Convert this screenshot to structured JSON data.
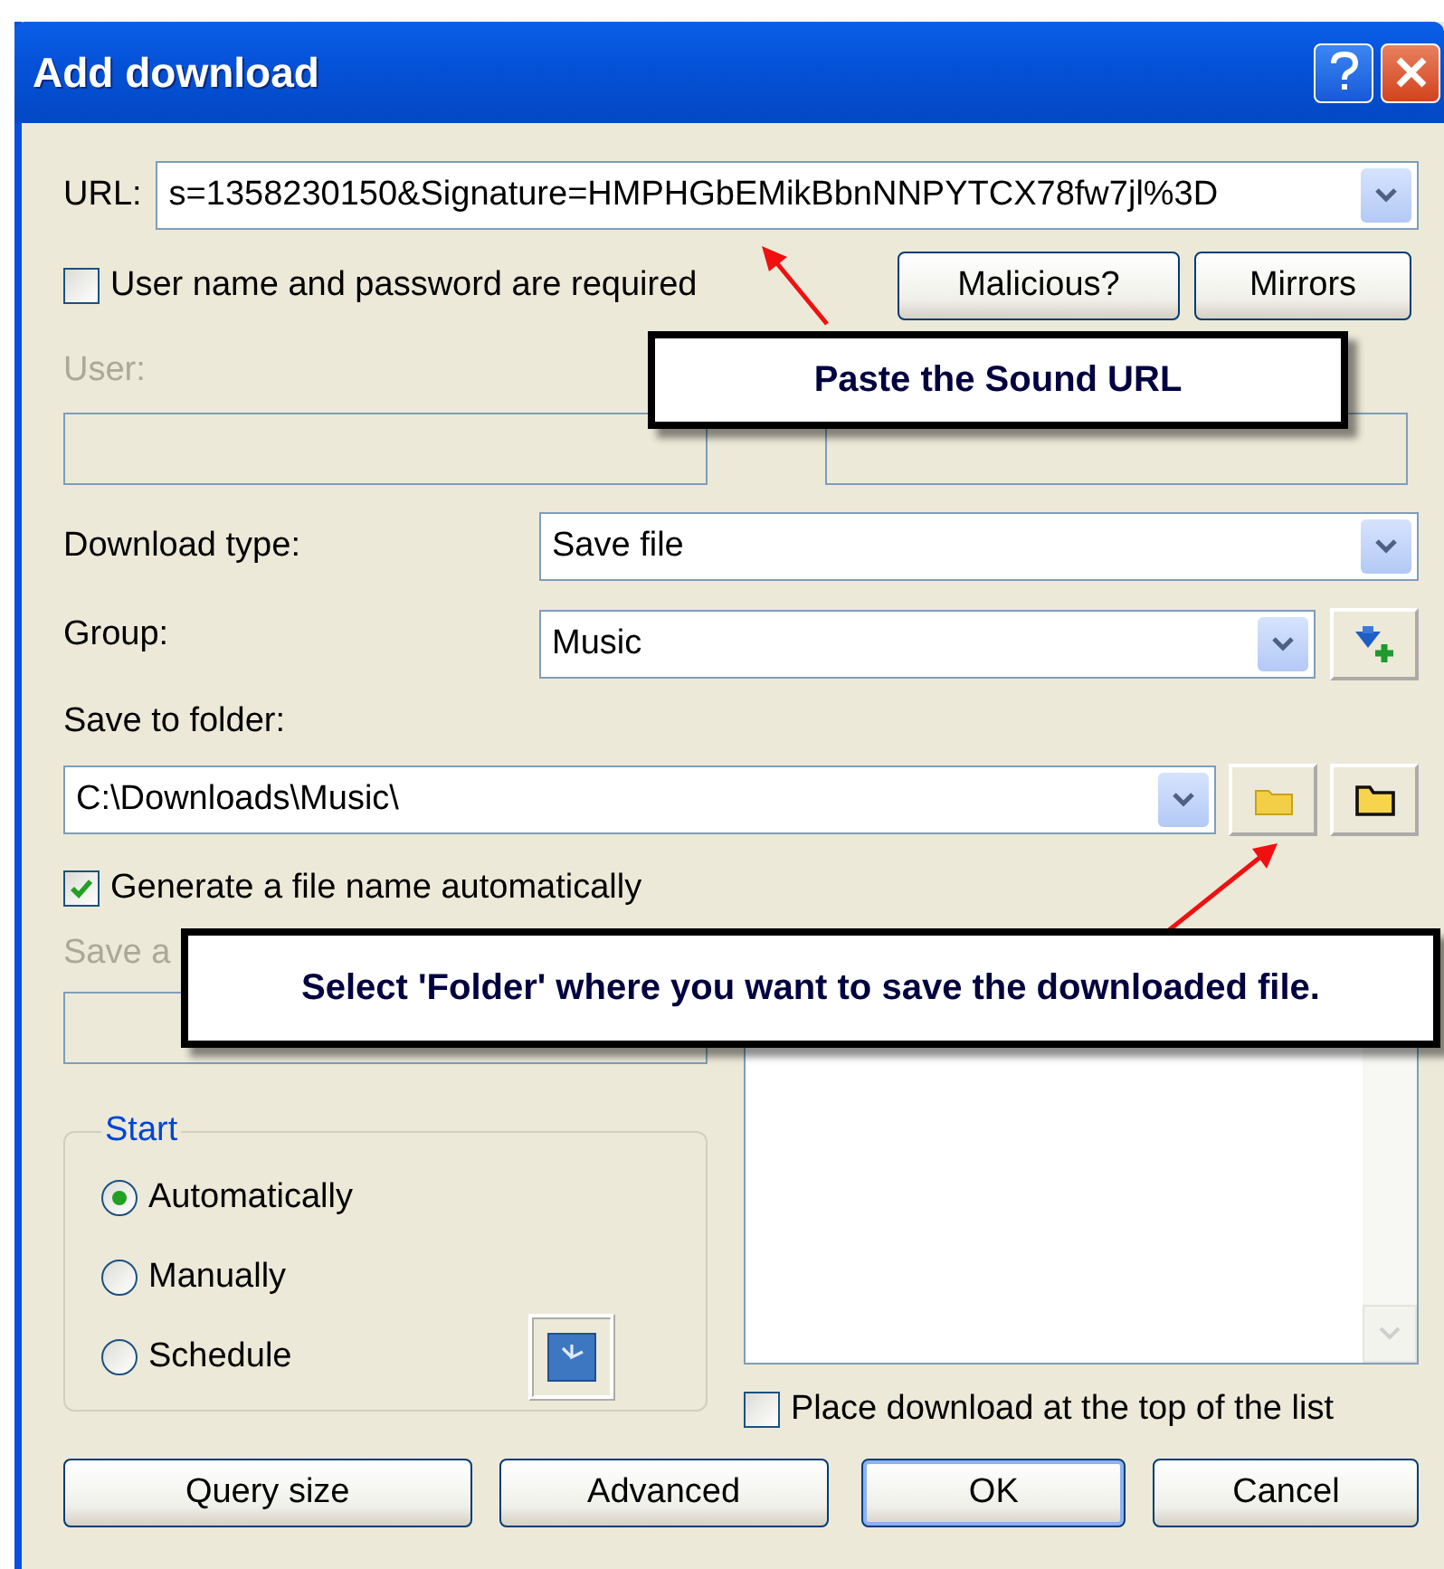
{
  "window": {
    "title": "Add download"
  },
  "url": {
    "label": "URL:",
    "value": "s=1358230150&Signature=HMPHGbEMikBbnNNPYTCX78fw7jl%3D"
  },
  "auth": {
    "label": "User name and password are required",
    "checked": false
  },
  "top_buttons": [
    "Malicious?",
    "Mirrors"
  ],
  "user": {
    "label": "User:",
    "disabled": true
  },
  "download_type": {
    "label": "Download type:",
    "value": "Save file"
  },
  "group": {
    "label": "Group:",
    "value": "Music"
  },
  "save_to_folder": {
    "label": "Save to folder:",
    "value": "C:\\Downloads\\Music\\"
  },
  "generate_name": {
    "label": "Generate a file name automatically",
    "checked": true
  },
  "save_as": {
    "label": "Save a",
    "disabled": true
  },
  "start": {
    "title": "Start",
    "options": [
      {
        "label": "Automatically",
        "selected": true
      },
      {
        "label": "Manually",
        "selected": false
      },
      {
        "label": "Schedule",
        "selected": false
      }
    ]
  },
  "place_top": {
    "label": "Place download at the top of the list",
    "checked": false
  },
  "buttons": [
    {
      "label": "Query size",
      "default": false
    },
    {
      "label": "Advanced",
      "default": false
    },
    {
      "label": "OK",
      "default": true
    },
    {
      "label": "Cancel",
      "default": false
    }
  ],
  "callouts": [
    {
      "text": "Paste the Sound URL"
    },
    {
      "text": "Select 'Folder' where you want to save the downloaded file."
    }
  ]
}
